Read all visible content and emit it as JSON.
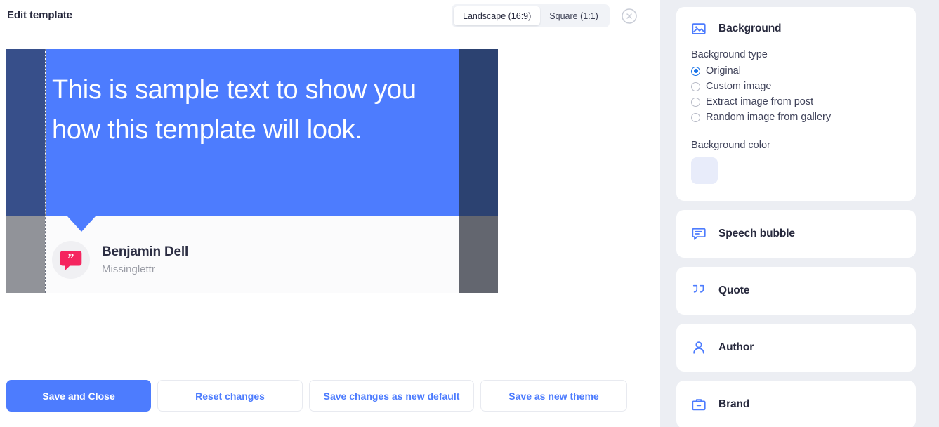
{
  "header": {
    "title": "Edit template",
    "aspect_options": [
      {
        "label": "Landscape (16:9)",
        "selected": true
      },
      {
        "label": "Square (1:1)",
        "selected": false
      }
    ],
    "close_icon": "close-circle-icon"
  },
  "canvas": {
    "quote_text": "This is sample text to show you how this template will look.",
    "author_name": "Benjamin Dell",
    "author_subtitle": "Missinglettr",
    "avatar_icon": "quote-bubble-avatar-icon",
    "bubble_color": "#4d7cfe",
    "margin_top_left_color": "#374f8a",
    "margin_bottom_left_color": "#919399",
    "margin_top_right_color": "#2c4271",
    "margin_bottom_right_color": "#63666f"
  },
  "footer": {
    "buttons": [
      {
        "label": "Save and Close",
        "style": "primary"
      },
      {
        "label": "Reset changes",
        "style": "ghost"
      },
      {
        "label": "Save changes as new default",
        "style": "ghost"
      },
      {
        "label": "Save as new theme",
        "style": "ghost"
      }
    ]
  },
  "sidebar": {
    "background_panel": {
      "title": "Background",
      "icon": "image-icon",
      "background_type_label": "Background type",
      "options": [
        {
          "label": "Original",
          "selected": true
        },
        {
          "label": "Custom image",
          "selected": false
        },
        {
          "label": "Extract image from post",
          "selected": false
        },
        {
          "label": "Random image from gallery",
          "selected": false
        }
      ],
      "background_color_label": "Background color",
      "background_color_value": "#e8ecfa"
    },
    "sections": [
      {
        "title": "Speech bubble",
        "icon": "speech-bubble-icon"
      },
      {
        "title": "Quote",
        "icon": "quote-marks-icon"
      },
      {
        "title": "Author",
        "icon": "person-icon"
      },
      {
        "title": "Brand",
        "icon": "briefcase-icon"
      }
    ]
  },
  "colors": {
    "accent": "#4d7cfe",
    "sidebar_bg": "#eceef3",
    "text_dark": "#27293d"
  }
}
